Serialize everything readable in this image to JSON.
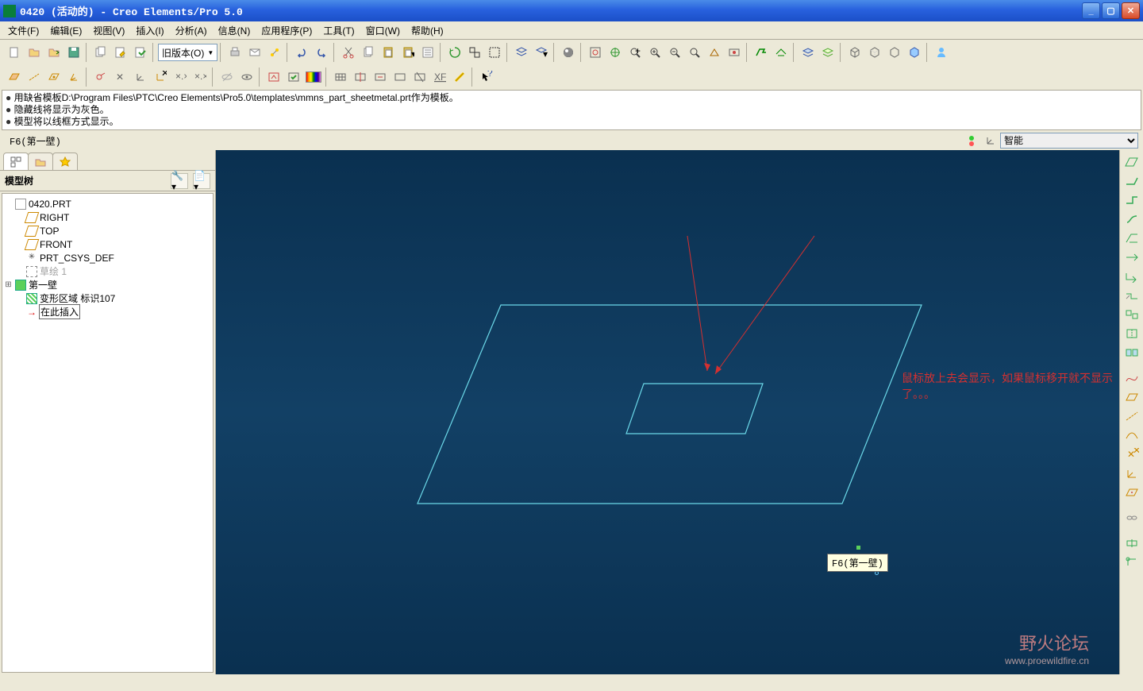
{
  "title": "0420 (活动的) - Creo Elements/Pro 5.0",
  "menus": [
    "文件(F)",
    "编辑(E)",
    "视图(V)",
    "插入(I)",
    "分析(A)",
    "信息(N)",
    "应用程序(P)",
    "工具(T)",
    "窗口(W)",
    "帮助(H)"
  ],
  "toolbar1_dropdown": "旧版本(O)",
  "messages": [
    "用缺省模板D:\\Program Files\\PTC\\Creo Elements\\Pro5.0\\templates\\mmns_part_sheetmetal.prt作为模板。",
    "隐藏线将显示为灰色。",
    "模型将以线框方式显示。"
  ],
  "selection_text": "F6(第一壁)",
  "filter_select": "智能",
  "tree_header": "模型树",
  "tree_root": "0420.PRT",
  "tree": {
    "right": "RIGHT",
    "top": "TOP",
    "front": "FRONT",
    "csys": "PRT_CSYS_DEF",
    "sketch": "草绘 1",
    "wall": "第一壁",
    "deform": "变形区域 标识107",
    "insert": "在此插入"
  },
  "tooltip": "F6(第一壁)",
  "annotation": "鼠标放上去会显示，如果鼠标移开就不显示了。。。",
  "watermark": {
    "line1": "野火论坛",
    "line2": "www.proewildfire.cn"
  }
}
